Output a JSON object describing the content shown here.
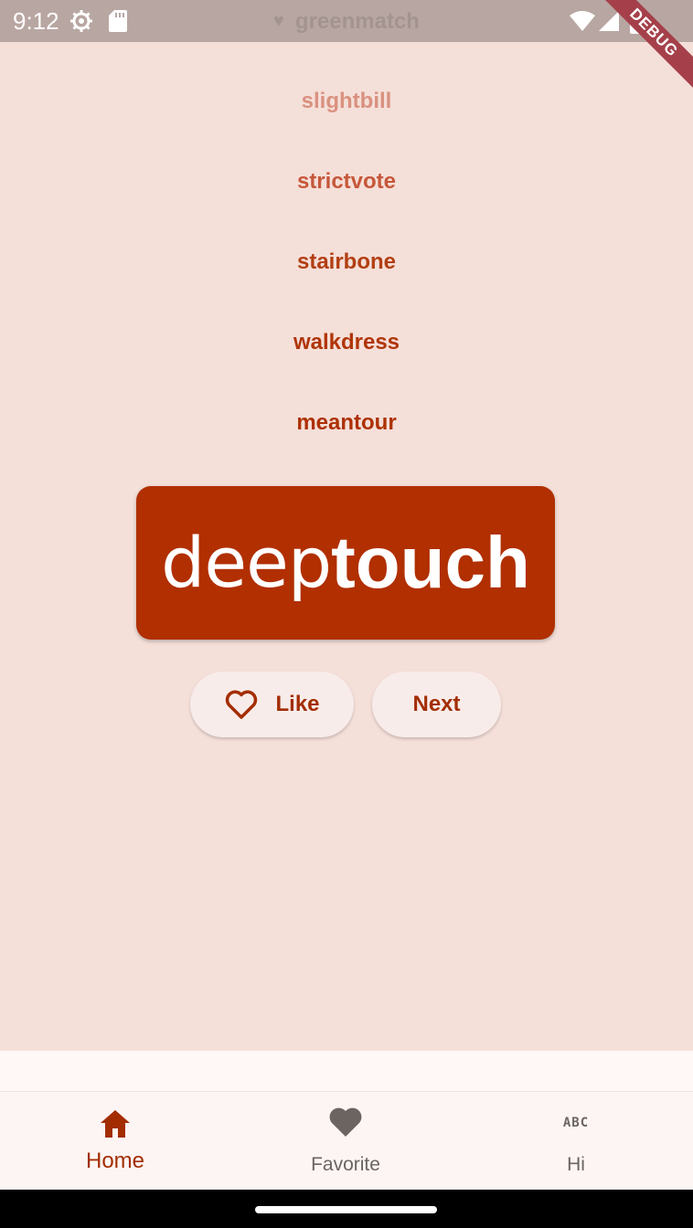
{
  "status_bar": {
    "time": "9:12",
    "icons": [
      "settings-icon",
      "sdcard-icon",
      "wifi-icon",
      "signal-icon",
      "battery-icon"
    ]
  },
  "debug_banner": "DEBUG",
  "history": {
    "top_faded_word": "greenmatch",
    "top_faded_is_favorite": true,
    "words": [
      "slightbill",
      "strictvote",
      "stairbone",
      "walkdress",
      "meantour"
    ]
  },
  "current_word": {
    "first": "deep",
    "second": "touch"
  },
  "buttons": {
    "like_label": "Like",
    "next_label": "Next"
  },
  "bottom_nav": {
    "items": [
      {
        "label": "Home",
        "icon": "home-icon",
        "selected": true
      },
      {
        "label": "Favorite",
        "icon": "heart-icon",
        "selected": false
      },
      {
        "label": "Hi",
        "icon": "abc-icon",
        "icon_text": "ABC",
        "selected": false
      }
    ]
  },
  "colors": {
    "background": "#f5dfd9",
    "primary": "#b12f00",
    "on_primary": "#ffffff",
    "button_bg": "#f8ecea",
    "nav_inactive": "#6b6461"
  }
}
